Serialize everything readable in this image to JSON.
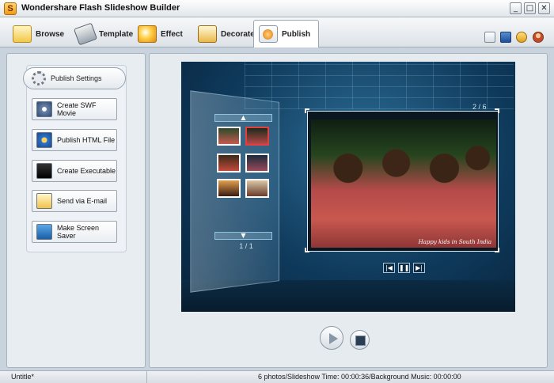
{
  "window": {
    "title": "Wondershare Flash Slideshow Builder",
    "controls": {
      "minimize": "_",
      "maximize": "□",
      "close": "✕"
    }
  },
  "toolbar": {
    "tabs": [
      {
        "label": "Browse",
        "icon": "folder-icon"
      },
      {
        "label": "Template",
        "icon": "template-icon"
      },
      {
        "label": "Effect",
        "icon": "effect-icon"
      },
      {
        "label": "Decorate",
        "icon": "decorate-icon"
      },
      {
        "label": "Publish",
        "icon": "publish-icon",
        "active": true
      }
    ],
    "utility_icons": [
      "new-project-icon",
      "save-icon",
      "settings-icon",
      "user-icon"
    ]
  },
  "sidebar": {
    "settings_label": "Publish Settings",
    "items": [
      {
        "label": "Create SWF Movie",
        "icon": "swf-icon"
      },
      {
        "label": "Publish HTML File",
        "icon": "ie-icon"
      },
      {
        "label": "Create Executable",
        "icon": "exe-icon"
      },
      {
        "label": "Send via E-mail",
        "icon": "email-icon"
      },
      {
        "label": "Make Screen Saver",
        "icon": "monitor-icon"
      }
    ]
  },
  "preview": {
    "photo_counter": "2 / 6",
    "thumb_page": "1 / 1",
    "caption": "Happy kids in South India",
    "thumbnail_count": 6,
    "selected_thumbnail": 2,
    "nav": {
      "first": "|◀",
      "pause": "❚❚",
      "last": "▶|"
    }
  },
  "statusbar": {
    "project": "Untitle*",
    "info": "6 photos/Slideshow Time: 00:00:36/Background Music: 00:00:00"
  },
  "colors": {
    "accent": "#2d6d94",
    "stage_dark": "#07223a",
    "selection": "#e24040"
  }
}
